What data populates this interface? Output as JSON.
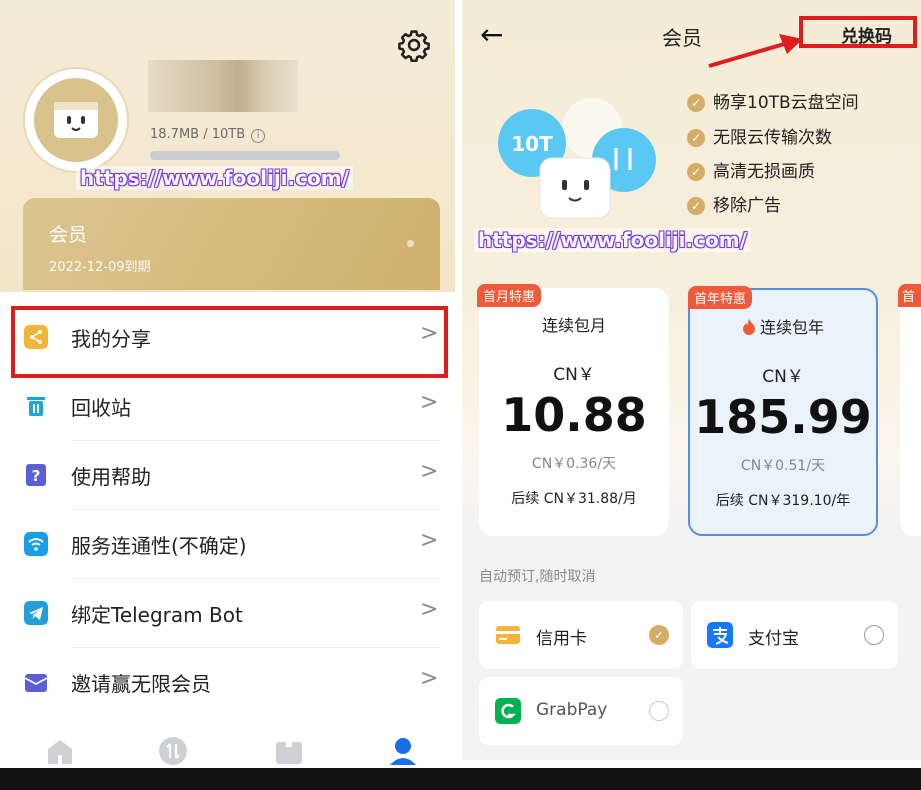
{
  "left": {
    "storage_text": "18.7MB / 10TB",
    "storage_info": "i",
    "watermark": "https://www.fooliji.com/",
    "vip": {
      "title": "会员",
      "expiry": "2022-12-09到期"
    },
    "menu": [
      {
        "label": "我的分享",
        "icon": "share-icon",
        "color": "#f2b43a"
      },
      {
        "label": "回收站",
        "icon": "trash-icon",
        "color": "#1aa7d6"
      },
      {
        "label": "使用帮助",
        "icon": "help-icon",
        "color": "#5a5fd8"
      },
      {
        "label": "服务连通性(不确定)",
        "icon": "wifi-icon",
        "color": "#1a9ee6"
      },
      {
        "label": "绑定Telegram Bot",
        "icon": "telegram-icon",
        "color": "#229ed9"
      },
      {
        "label": "邀请赢无限会员",
        "icon": "invite-envelope-icon",
        "color": "#5a5fd8"
      }
    ],
    "chevron": ">",
    "tabs": [
      "home-icon",
      "transfer-icon",
      "box-icon",
      "profile-icon"
    ]
  },
  "right": {
    "back": "←",
    "title": "会员",
    "redeem": "兑换码",
    "features": [
      "畅享10TB云盘空间",
      "无限云传输次数",
      "高清无损画质",
      "移除广告"
    ],
    "watermark": "https://www.fooliji.com/",
    "mascot_label": "10T",
    "plans": [
      {
        "badge": "首月特惠",
        "name": "连续包月",
        "currency": "CN￥",
        "price": "10.88",
        "daily": "CN￥0.36/天",
        "renew": "后续 CN￥31.88/月",
        "hot": false
      },
      {
        "badge": "首年特惠",
        "name": "连续包年",
        "currency": "CN￥",
        "price": "185.99",
        "daily": "CN￥0.51/天",
        "renew": "后续 CN￥319.10/年",
        "hot": true
      }
    ],
    "plan3_badge": "首",
    "auto_note": "自动预订,随时取消",
    "payments": [
      {
        "label": "信用卡",
        "selected": true
      },
      {
        "label": "支付宝",
        "selected": false
      },
      {
        "label": "GrabPay",
        "selected": false
      }
    ],
    "check_glyph": "✓"
  },
  "colors": {
    "accent_gold": "#d6ad68",
    "highlight_red": "#e01d1d",
    "selected_border": "#5a8ee0",
    "badge_red": "#ef5a3a"
  }
}
